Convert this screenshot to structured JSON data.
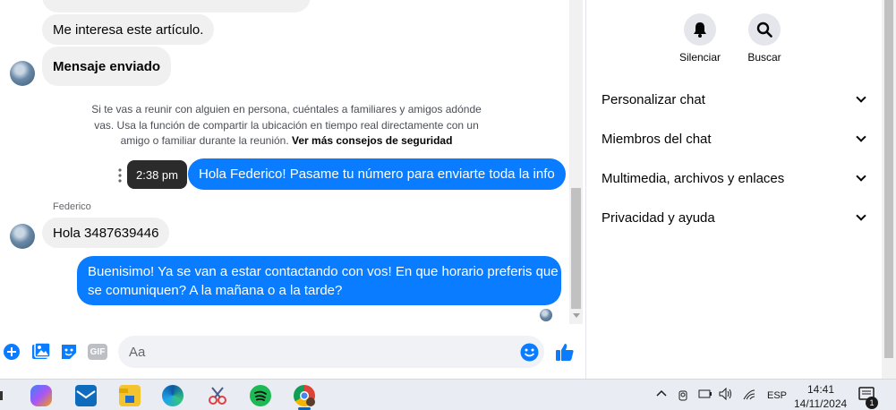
{
  "messages": {
    "in1_partial": "",
    "in2": "Me interesa este artículo.",
    "in3": "Mensaje enviado",
    "safety_text": "Si te vas a reunir con alguien en persona, cuéntales a familiares y amigos adónde vas. Usa la función de compartir la ubicación en tiempo real directamente con un amigo o familiar durante la reunión.",
    "safety_link": "Ver más consejos de seguridad",
    "time_tooltip": "2:38 pm",
    "out1": "Hola Federico! Pasame tu número para enviarte toda la info",
    "sender_name": "Federico",
    "in4": "Hola 3487639446",
    "out2_line1": "Buenisimo! Ya se van a estar contactando con vos! En que horario preferis que",
    "out2_line2": "se comuniquen? A la mañana o a la tarde?"
  },
  "composer": {
    "placeholder": "Aa",
    "gif_label": "GIF"
  },
  "panel": {
    "mute_label": "Silenciar",
    "search_label": "Buscar",
    "sections": [
      "Personalizar chat",
      "Miembros del chat",
      "Multimedia, archivos y enlaces",
      "Privacidad y ayuda"
    ]
  },
  "taskbar": {
    "lang": "ESP",
    "time": "14:41",
    "date": "14/11/2024",
    "notif_count": "1"
  },
  "colors": {
    "accent": "#0a7cff",
    "incoming": "#f0f0f0"
  }
}
